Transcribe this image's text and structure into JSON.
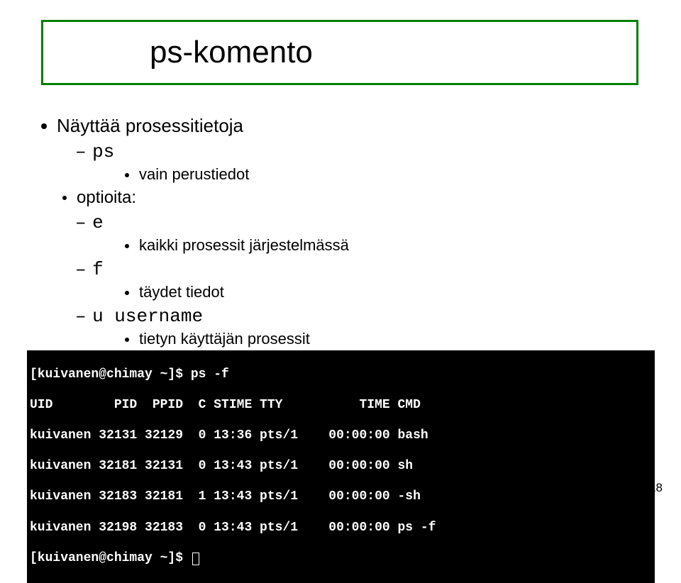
{
  "title": "ps-komento",
  "bullets": {
    "main": "Näyttää prosessitietoja",
    "cmd": "ps",
    "cmd_desc": "vain perustiedot",
    "options_label": "optioita:",
    "opt_e": "e",
    "opt_e_desc": "kaikki prosessit järjestelmässä",
    "opt_f": "f",
    "opt_f_desc": "täydet tiedot",
    "opt_u": "u username",
    "opt_u_desc": "tietyn käyttäjän prosessit"
  },
  "terminal": {
    "lines": [
      "[kuivanen@chimay ~]$ ps -f",
      "UID        PID  PPID  C STIME TTY          TIME CMD",
      "kuivanen 32131 32129  0 13:36 pts/1    00:00:00 bash",
      "kuivanen 32181 32131  0 13:43 pts/1    00:00:00 sh",
      "kuivanen 32183 32181  1 13:43 pts/1    00:00:00 -sh",
      "kuivanen 32198 32183  0 13:43 pts/1    00:00:00 ps -f",
      "[kuivanen@chimay ~]$ "
    ]
  },
  "page_number": "18"
}
